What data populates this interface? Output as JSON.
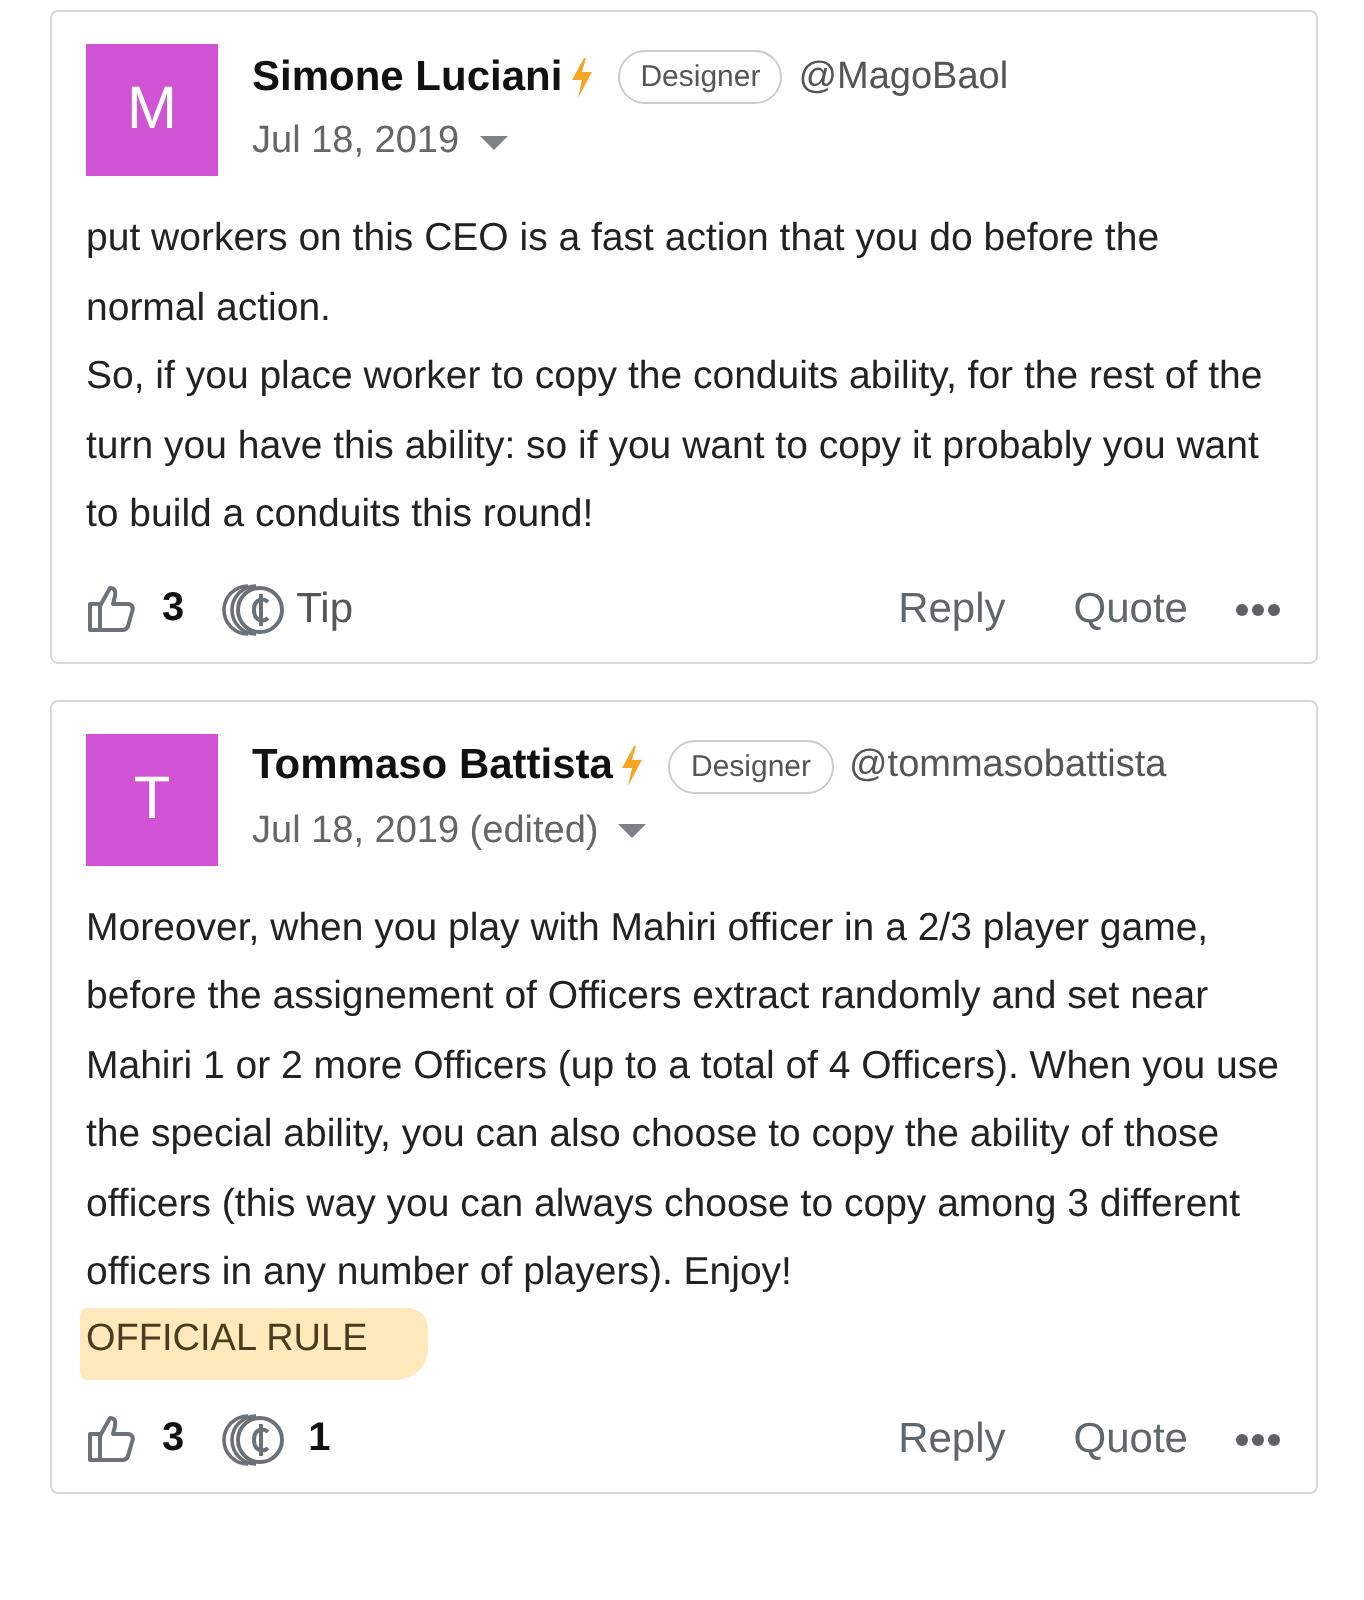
{
  "posts": [
    {
      "avatar": {
        "letter": "M",
        "color": "#d053d4"
      },
      "author": "Simone Luciani",
      "badge": "Designer",
      "handle": "@MagoBaol",
      "date": "Jul 18, 2019",
      "paragraphs": [
        "put workers on this CEO is a fast action that you do before the normal action.",
        "So, if you place worker to copy the conduits ability, for the rest of the turn you have this ability: so if you want to copy it probably you want to build a conduits this round!"
      ],
      "likes": "3",
      "tip": "Tip",
      "actions": [
        "Reply",
        "Quote"
      ]
    },
    {
      "avatar": {
        "letter": "T",
        "color": "#d053d4"
      },
      "author": "Tommaso Battista",
      "badge": "Designer",
      "handle": "@tommasobattista",
      "date": "Jul 18, 2019 (edited)",
      "paragraphs": [
        "Moreover, when you play with Mahiri officer in a 2/3 player game, before the assignement of Officers extract randomly and set near Mahiri 1 or 2 more Officers (up to a total of 4 Officers). When you use the special ability, you can also choose to copy the ability of those officers (this way you can always choose to copy among 3 different officers in any number of players). Enjoy!"
      ],
      "note": {
        "text": "OFFICIAL RULE",
        "highlighted": true
      },
      "likes": "3",
      "tip": "1",
      "actions": [
        "Reply",
        "Quote"
      ]
    }
  ]
}
